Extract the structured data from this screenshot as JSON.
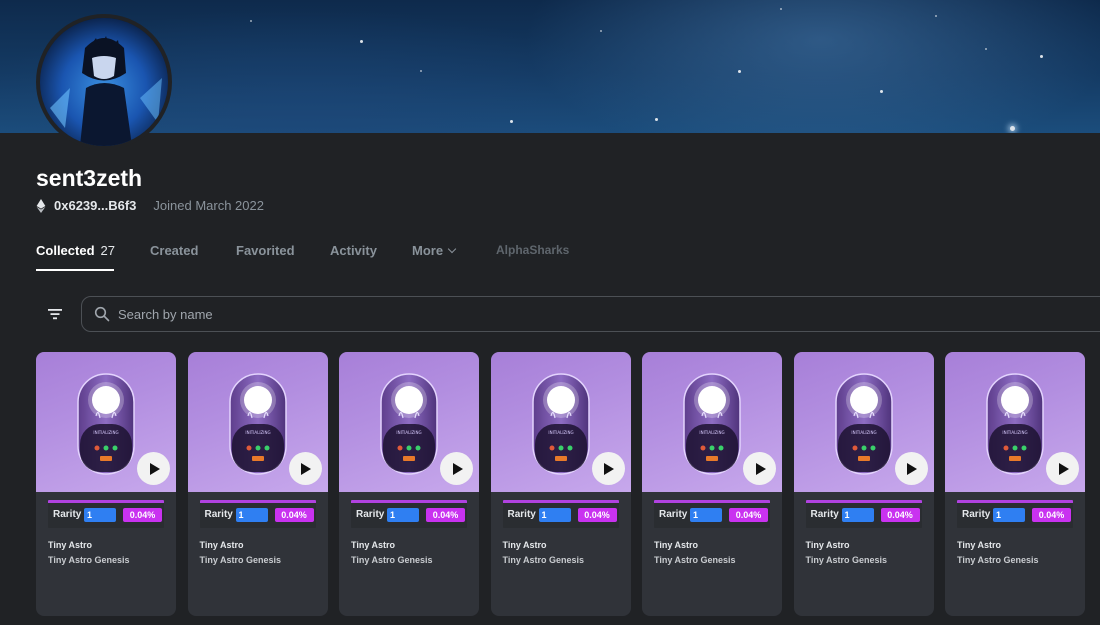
{
  "profile": {
    "username": "sent3zeth",
    "address": "0x6239...B6f3",
    "joined": "Joined March 2022",
    "eth_icon": "ethereum-icon"
  },
  "tabs": [
    {
      "label": "Collected",
      "count": "27"
    },
    {
      "label": "Created"
    },
    {
      "label": "Favorited"
    },
    {
      "label": "Activity"
    },
    {
      "label": "More"
    },
    {
      "label": "AlphaSharks"
    }
  ],
  "search": {
    "placeholder": "Search by name",
    "filter_icon": "filter-icon",
    "search_icon": "search-icon"
  },
  "colors": {
    "rank_badge": "#2f7ff2",
    "percent_badge": "#c932f0",
    "rarity_bar": "#b042e0"
  },
  "cards": [
    {
      "name": "Tiny Astro",
      "collection": "Tiny Astro Genesis",
      "rarity_label": "Rarity",
      "rank": "1",
      "percent": "0.04%"
    },
    {
      "name": "Tiny Astro",
      "collection": "Tiny Astro Genesis",
      "rarity_label": "Rarity",
      "rank": "1",
      "percent": "0.04%"
    },
    {
      "name": "Tiny Astro",
      "collection": "Tiny Astro Genesis",
      "rarity_label": "Rarity",
      "rank": "1",
      "percent": "0.04%"
    },
    {
      "name": "Tiny Astro",
      "collection": "Tiny Astro Genesis",
      "rarity_label": "Rarity",
      "rank": "1",
      "percent": "0.04%"
    },
    {
      "name": "Tiny Astro",
      "collection": "Tiny Astro Genesis",
      "rarity_label": "Rarity",
      "rank": "1",
      "percent": "0.04%"
    },
    {
      "name": "Tiny Astro",
      "collection": "Tiny Astro Genesis",
      "rarity_label": "Rarity",
      "rank": "1",
      "percent": "0.04%"
    },
    {
      "name": "Tiny Astro",
      "collection": "Tiny Astro Genesis",
      "rarity_label": "Rarity",
      "rank": "1",
      "percent": "0.04%"
    }
  ]
}
